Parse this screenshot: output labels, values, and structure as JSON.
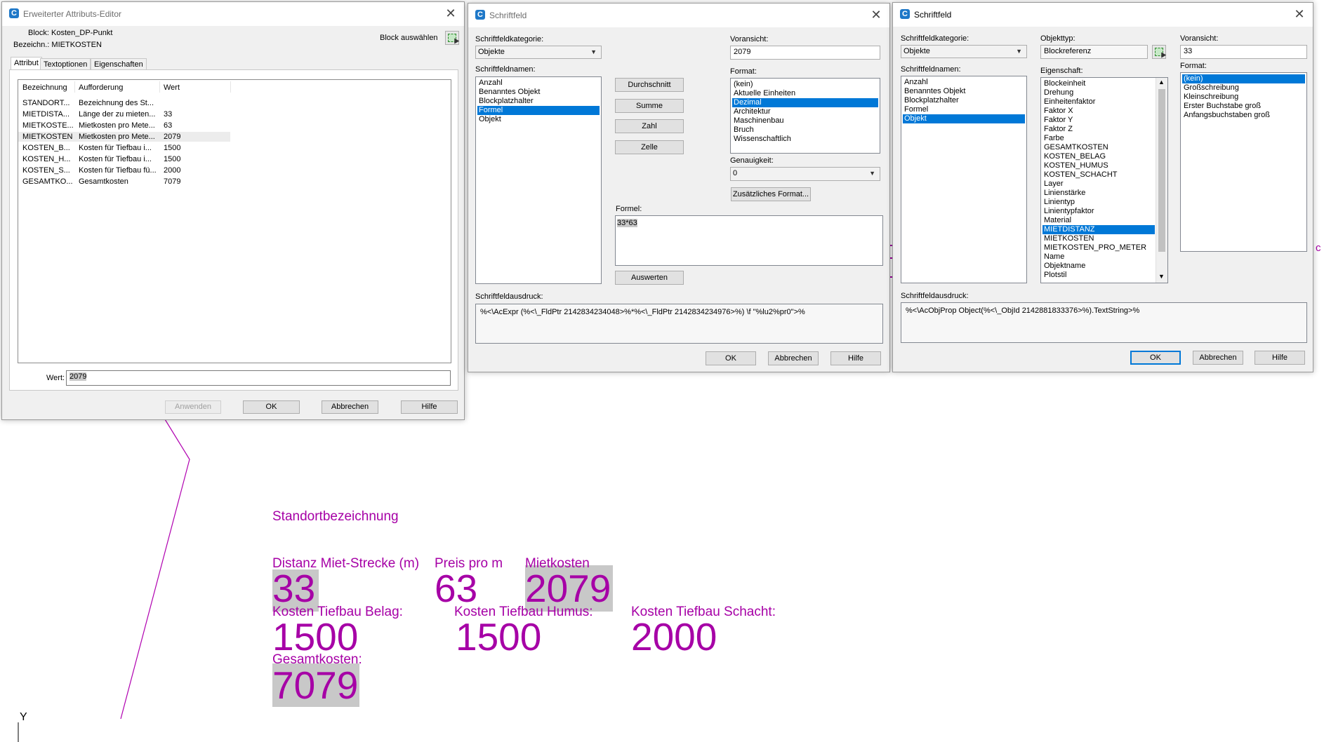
{
  "attr_editor": {
    "title": "Erweiterter Attributs-Editor",
    "block_label": "Block: Kosten_DP-Punkt",
    "bezeich_label": "Bezeichn.: MIETKOSTEN",
    "block_select": "Block auswählen",
    "tabs": [
      "Attribut",
      "Textoptionen",
      "Eigenschaften"
    ],
    "columns": [
      "Bezeichnung",
      "Aufforderung",
      "Wert"
    ],
    "rows": [
      {
        "tag": "STANDORT...",
        "prompt": "Bezeichnung des St...",
        "value": ""
      },
      {
        "tag": "MIETDISTA...",
        "prompt": "Länge der zu mieten...",
        "value": "33"
      },
      {
        "tag": "MIETKOSTE...",
        "prompt": "Mietkosten pro Mete...",
        "value": "63"
      },
      {
        "tag": "MIETKOSTEN",
        "prompt": "Mietkosten pro Mete...",
        "value": "2079"
      },
      {
        "tag": "KOSTEN_B...",
        "prompt": "Kosten für Tiefbau i...",
        "value": "1500"
      },
      {
        "tag": "KOSTEN_H...",
        "prompt": "Kosten für Tiefbau i...",
        "value": "1500"
      },
      {
        "tag": "KOSTEN_S...",
        "prompt": "Kosten für Tiefbau fü...",
        "value": "2000"
      },
      {
        "tag": "GESAMTKO...",
        "prompt": "Gesamtkosten",
        "value": "7079"
      }
    ],
    "wert_label": "Wert:",
    "wert_value": "2079",
    "buttons": {
      "apply": "Anwenden",
      "ok": "OK",
      "cancel": "Abbrechen",
      "help": "Hilfe"
    }
  },
  "field1": {
    "title": "Schriftfeld",
    "category_label": "Schriftfeldkategorie:",
    "category_value": "Objekte",
    "names_label": "Schriftfeldnamen:",
    "names": [
      "Anzahl",
      "Benanntes Objekt",
      "Blockplatzhalter",
      "Formel",
      "Objekt"
    ],
    "names_selected": 3,
    "mid_buttons": [
      "Durchschnitt",
      "Summe",
      "Zahl",
      "Zelle"
    ],
    "preview_label": "Voransicht:",
    "preview_value": "2079",
    "format_label": "Format:",
    "formats": [
      "(kein)",
      "Aktuelle Einheiten",
      "Dezimal",
      "Architektur",
      "Maschinenbau",
      "Bruch",
      "Wissenschaftlich"
    ],
    "formats_selected": 2,
    "precision_label": "Genauigkeit:",
    "precision_value": "0",
    "extra_format": "Zusätzliches Format...",
    "formula_label": "Formel:",
    "formula_value": "33*63",
    "evaluate": "Auswerten",
    "expr_label": "Schriftfeldausdruck:",
    "expr_value": "%<\\AcExpr (%<\\_FldPtr 2142834234048>%*%<\\_FldPtr 2142834234976>%) \\f \"%lu2%pr0\">%",
    "buttons": {
      "ok": "OK",
      "cancel": "Abbrechen",
      "help": "Hilfe"
    }
  },
  "field2": {
    "title": "Schriftfeld",
    "category_label": "Schriftfeldkategorie:",
    "category_value": "Objekte",
    "names_label": "Schriftfeldnamen:",
    "names": [
      "Anzahl",
      "Benanntes Objekt",
      "Blockplatzhalter",
      "Formel",
      "Objekt"
    ],
    "names_selected": 4,
    "objtype_label": "Objekttyp:",
    "objtype_value": "Blockreferenz",
    "property_label": "Eigenschaft:",
    "properties": [
      "Blockeinheit",
      "Drehung",
      "Einheitenfaktor",
      "Faktor X",
      "Faktor Y",
      "Faktor Z",
      "Farbe",
      "GESAMTKOSTEN",
      "KOSTEN_BELAG",
      "KOSTEN_HUMUS",
      "KOSTEN_SCHACHT",
      "Layer",
      "Linienstärke",
      "Linientyp",
      "Linientypfaktor",
      "Material",
      "MIETDISTANZ",
      "MIETKOSTEN",
      "MIETKOSTEN_PRO_METER",
      "Name",
      "Objektname",
      "Plotstil"
    ],
    "properties_selected": 16,
    "preview_label": "Voransicht:",
    "preview_value": "33",
    "format_label": "Format:",
    "formats": [
      "(kein)",
      "Großschreibung",
      "Kleinschreibung",
      "Erster Buchstabe groß",
      "Anfangsbuchstaben groß"
    ],
    "formats_selected": 0,
    "expr_label": "Schriftfeldausdruck:",
    "expr_value": "%<\\AcObjProp Object(%<\\_ObjId 2142881833376>%).TextString>%",
    "buttons": {
      "ok": "OK",
      "cancel": "Abbrechen",
      "help": "Hilfe"
    }
  },
  "drawing": {
    "color": "#a600a6",
    "standort": "Standortbezeichnung",
    "distanz_label": "Distanz Miet-Strecke (m)",
    "distanz_value": "33",
    "preis_label": "Preis pro m",
    "preis_value": "63",
    "miet_label": "Mietkosten",
    "miet_value": "2079",
    "belag_label": "Kosten Tiefbau Belag:",
    "belag_value": "1500",
    "humus_label": "Kosten Tiefbau Humus:",
    "humus_value": "1500",
    "schacht_label": "Kosten Tiefbau Schacht:",
    "schacht_value": "2000",
    "gesamt_label": "Gesamtkosten:",
    "gesamt_value": "7079",
    "ucs_y": "Y"
  }
}
